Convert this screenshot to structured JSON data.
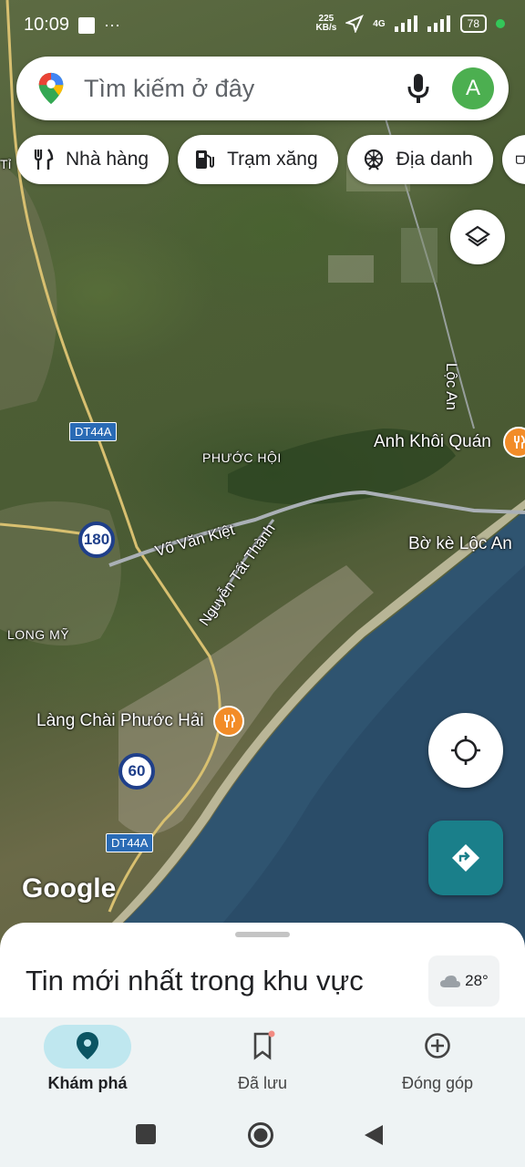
{
  "status_bar": {
    "time": "10:09",
    "more": "···",
    "speed_value": "225",
    "speed_unit": "KB/s",
    "network": "4G",
    "battery": "78"
  },
  "search": {
    "placeholder": "Tìm kiếm ở đây",
    "avatar_letter": "A"
  },
  "chips": [
    {
      "label": "Nhà hàng",
      "icon": "fork-knife-icon"
    },
    {
      "label": "Trạm xăng",
      "icon": "gas-station-icon"
    },
    {
      "label": "Địa danh",
      "icon": "landmark-icon"
    },
    {
      "label": "",
      "icon": "coffee-icon"
    }
  ],
  "map": {
    "labels": {
      "phuoc_hoi": "PHƯỚC HỘI",
      "long_my": "LONG MỸ",
      "vo_van_kiet": "Võ Văn Kiệt",
      "nguyen_tat_thanh": "Nguyễn Tất Thành",
      "loc_an": "Lộc An",
      "tl": "Tỉ"
    },
    "pois": {
      "anh_khoi_quan": "Anh Khôi Quán",
      "bo_ke_loc_an": "Bờ kè Lộc An",
      "lang_chai": "Làng Chài Phước Hải"
    },
    "route_shields": {
      "r180": "180",
      "r60": "60"
    },
    "road_signs": {
      "dt44a_top": "DT44A",
      "dt44a_bottom": "DT44A"
    },
    "attribution": "Google"
  },
  "sheet": {
    "title": "Tin mới nhất trong khu vực",
    "weather_temp": "28°"
  },
  "bottom_nav": [
    {
      "label": "Khám phá",
      "icon": "explore-pin-icon",
      "active": true
    },
    {
      "label": "Đã lưu",
      "icon": "bookmark-icon",
      "active": false
    },
    {
      "label": "Đóng góp",
      "icon": "add-circle-icon",
      "active": false
    }
  ],
  "colors": {
    "accent": "#1a7f8a",
    "poi": "#f28c28",
    "nav_active_pill": "#bfe7ef"
  }
}
